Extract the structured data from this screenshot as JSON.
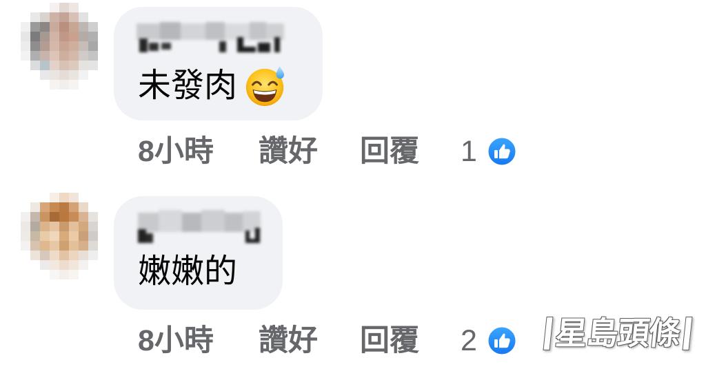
{
  "comments": [
    {
      "text": "未發肉",
      "emoji_icon": "grinning-face-with-sweat-icon",
      "time": "8小時",
      "like_label": "讚好",
      "reply_label": "回覆",
      "reaction_count": "1",
      "reaction_icon": "like-thumbs-up-icon"
    },
    {
      "text": "嫩嫩的",
      "time": "8小時",
      "like_label": "讚好",
      "reply_label": "回覆",
      "reaction_count": "2",
      "reaction_icon": "like-thumbs-up-icon"
    }
  ],
  "watermark": {
    "text": "星島頭條"
  },
  "colors": {
    "bubble_bg": "#f0f2f5",
    "meta_text": "#65676b",
    "comment_text": "#050505",
    "reaction_blue": "#1877f2"
  }
}
